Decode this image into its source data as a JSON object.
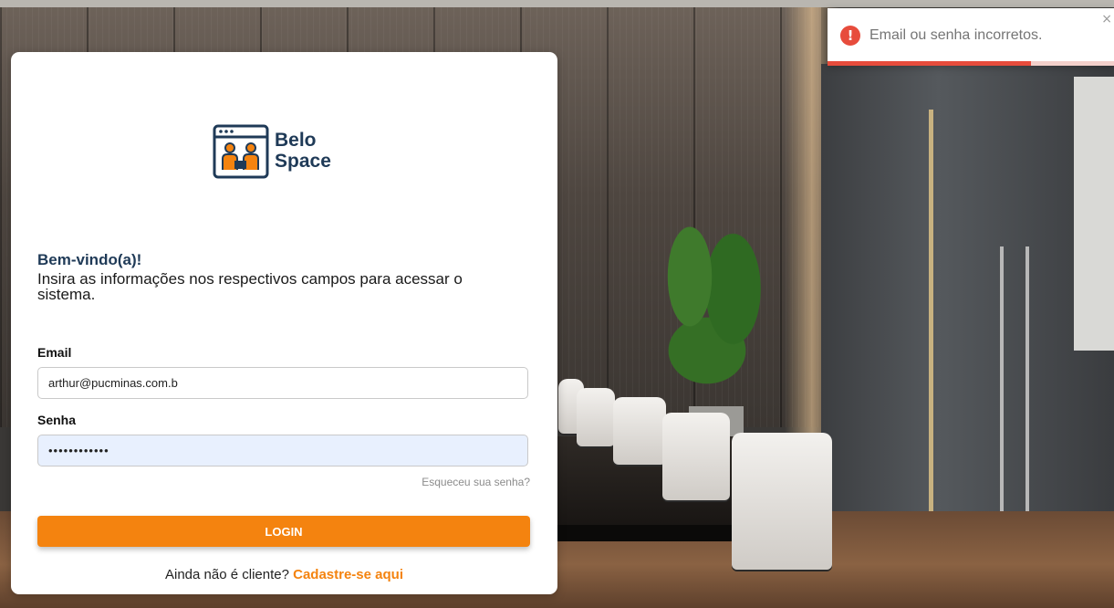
{
  "brand": {
    "name_line1": "Belo",
    "name_line2": "Space",
    "icon": "coworking-logo-icon"
  },
  "card": {
    "welcome": "Bem-vindo(a)!",
    "subtitle": "Insira as informações nos respectivos campos para acessar o sistema."
  },
  "form": {
    "email_label": "Email",
    "email_value": "arthur@pucminas.com.b",
    "password_label": "Senha",
    "password_value": "••••••••••••",
    "forgot_link": "Esqueceu sua senha?",
    "login_button": "LOGIN"
  },
  "signup": {
    "prompt": "Ainda não é cliente?",
    "link": "Cadastre-se aqui"
  },
  "toast": {
    "message": "Email ou senha incorretos.",
    "icon": "error-icon",
    "close": "×",
    "progress": 0.71
  },
  "colors": {
    "accent": "#f4830f",
    "brand_dark": "#1f3a57",
    "error": "#e74c3c"
  }
}
